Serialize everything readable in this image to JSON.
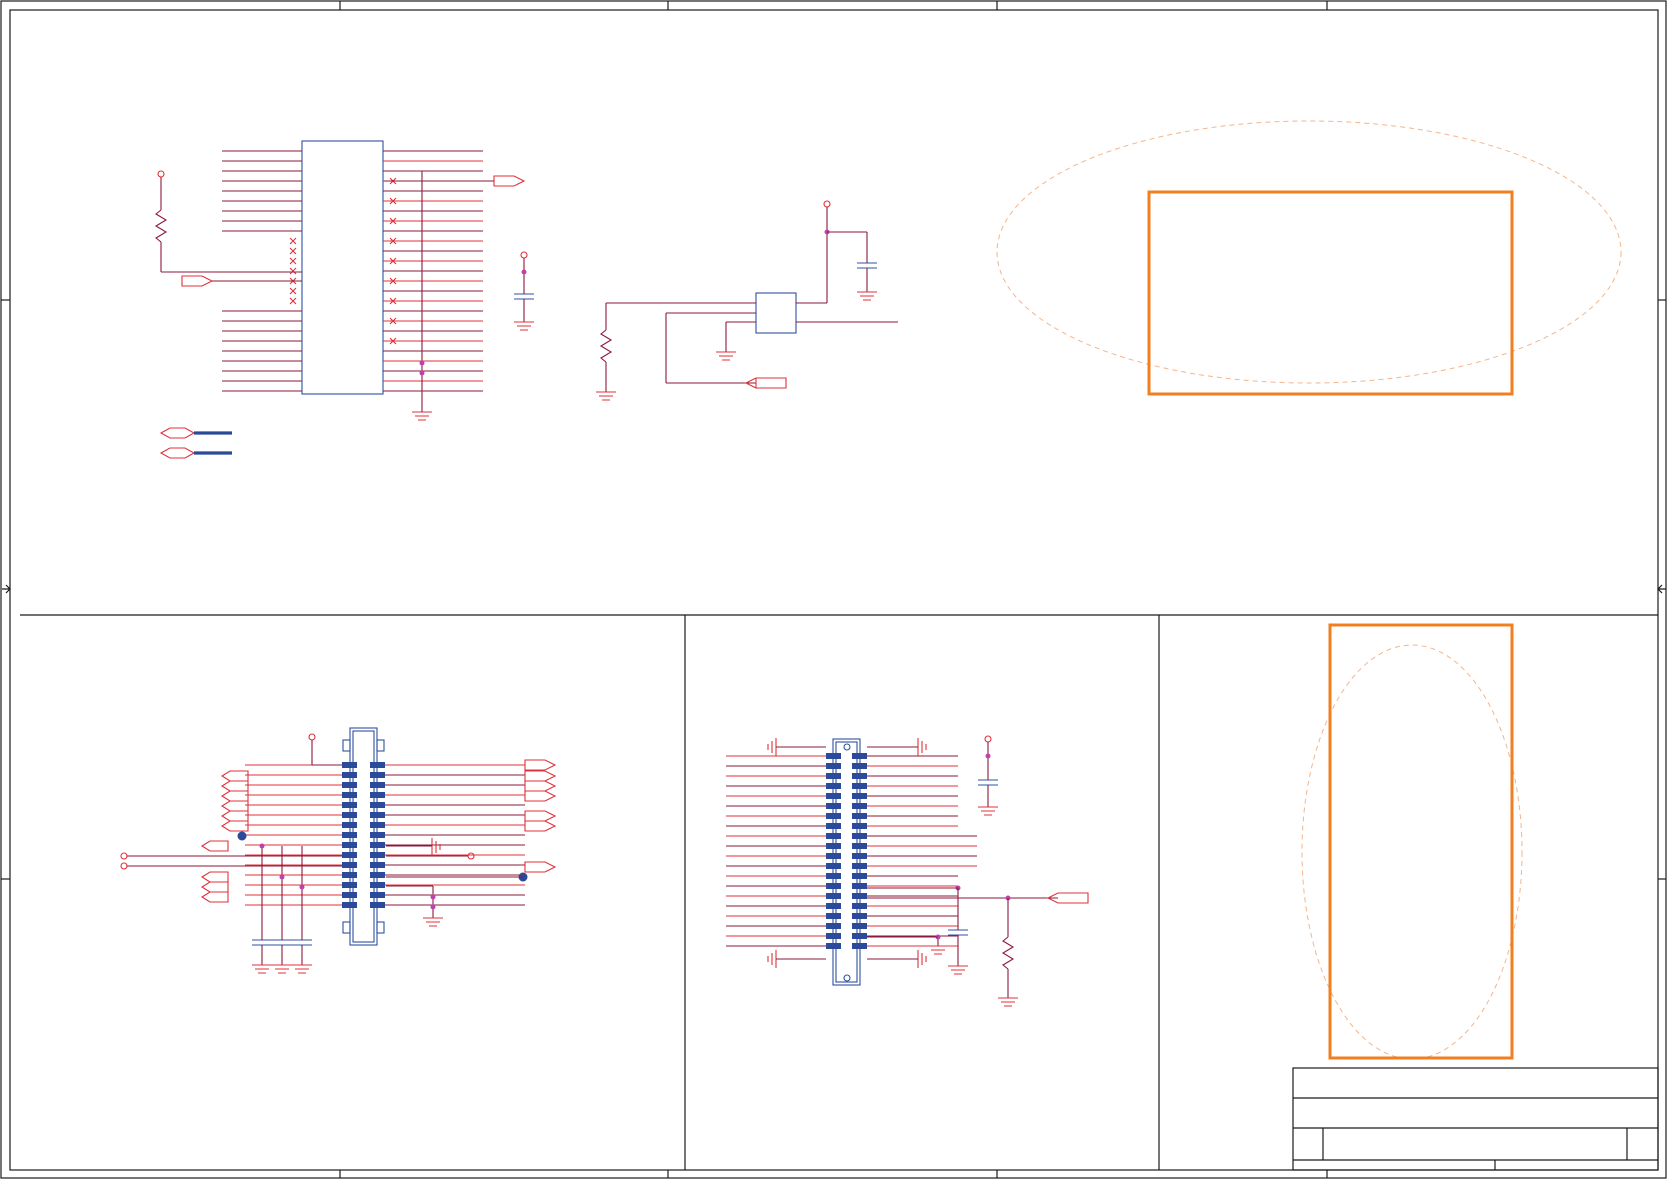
{
  "sheet": {
    "background": "#ffffff",
    "frame_color": "#1a1a1a",
    "wire_color": "#8b1a3a",
    "pin_color": "#e0303a",
    "body_color": "#3050a0",
    "highlight_color": "#f07f20",
    "dash_color": "#f5b58a"
  },
  "sections": [
    {
      "id": "top-region",
      "components": [
        "ic-u1",
        "ic-u2",
        "resistor",
        "capacitor"
      ]
    },
    {
      "id": "bottom-left-region",
      "components": [
        "connector-j1",
        "capacitor-bank"
      ]
    },
    {
      "id": "bottom-middle-region",
      "components": [
        "connector-j2",
        "capacitor",
        "resistor"
      ]
    },
    {
      "id": "bottom-right-region",
      "components": [
        "highlight-box"
      ]
    }
  ],
  "title_block": {
    "rows": 3
  }
}
